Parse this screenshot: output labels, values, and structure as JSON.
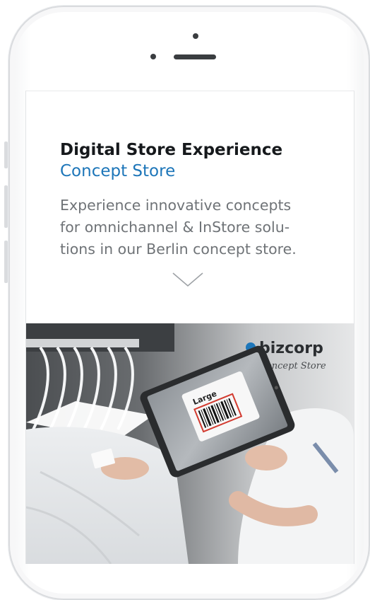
{
  "hero_section": {
    "title": "Digital Store Experience",
    "subtitle": "Concept Store",
    "description_lines": [
      "Experience innovative concepts",
      "for omnichannel & InStore solu-",
      "tions in our Berlin concept store."
    ],
    "scroll_icon": "chevron-down-icon"
  },
  "photo": {
    "wall_sign_line1": "bizcorp",
    "wall_sign_line2": "Concept Store",
    "tag_label": "Large"
  },
  "colors": {
    "accent": "#1d76b9",
    "heading": "#16191c",
    "body_text": "#6f7377"
  }
}
